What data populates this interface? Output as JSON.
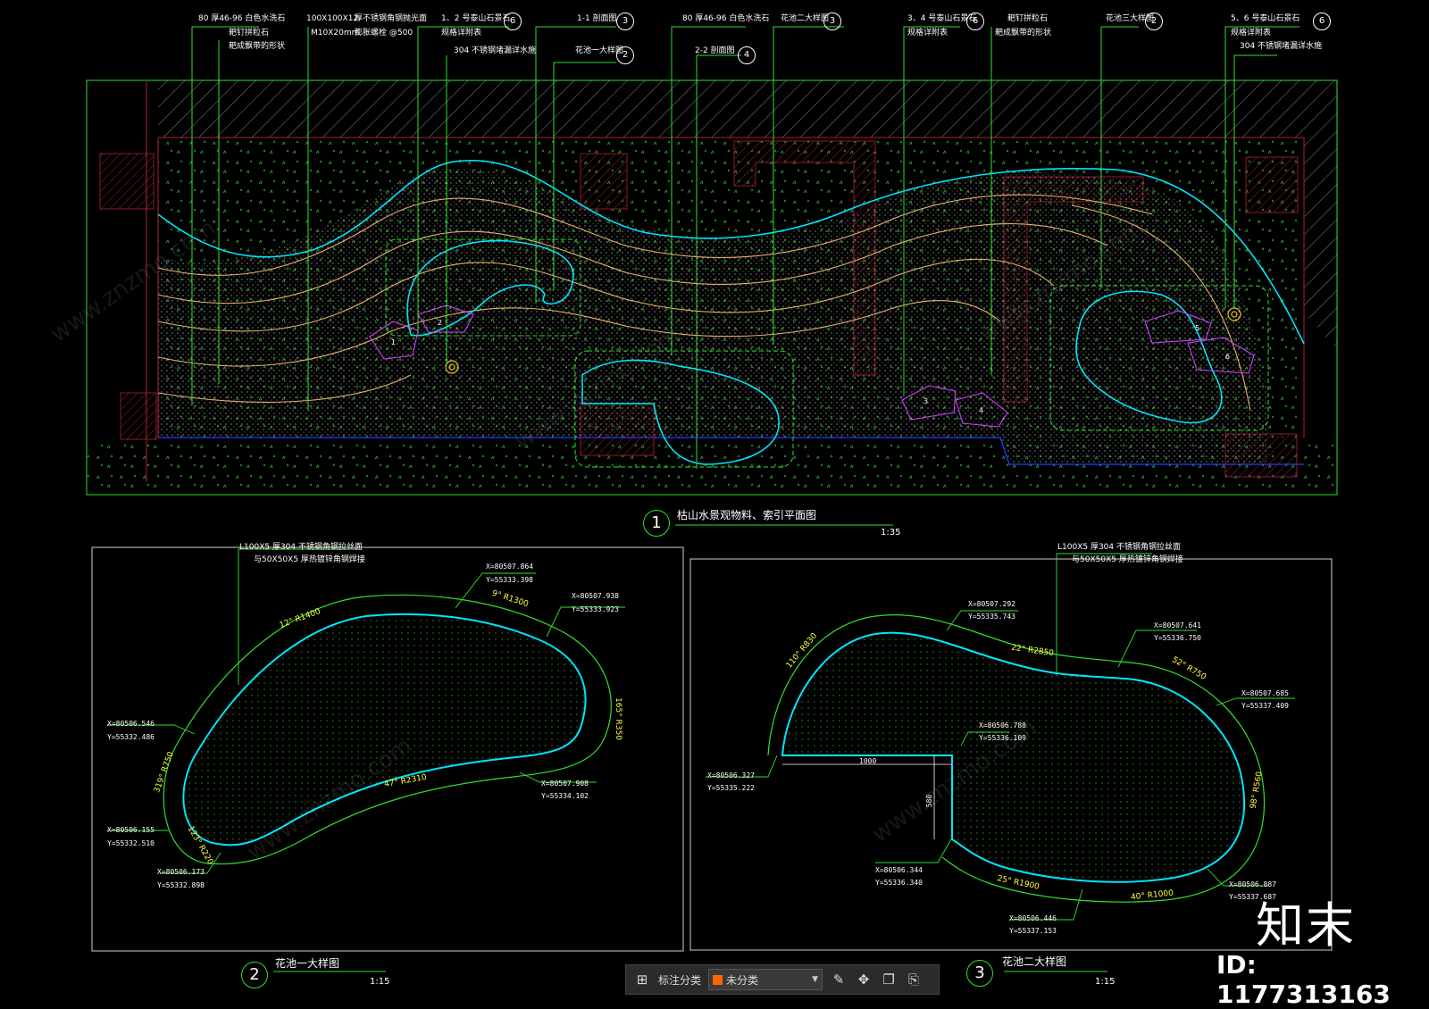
{
  "colors": {
    "bg": "#000000",
    "green": "#2ee02e",
    "cyan": "#00e5ff",
    "wall": "#8b1a2a",
    "tan": "#e8b070",
    "magenta": "#d040ff",
    "blue": "#2040ff",
    "white": "#ffffff",
    "yellow": "#ffff40"
  },
  "top_labels": {
    "l1a": "80 厚46-96 白色水洗石",
    "l1b": "耙钉拼粒石",
    "l1c": "耙成飘带的形状",
    "l2a": "100X100X12",
    "l2b": "M10X20mm",
    "l3a": "厚不锈钢角钢抛光面",
    "l3b": "膨胀螺栓 @500",
    "l4a": "1、2 号泰山石景石",
    "l4b": "规格详附表",
    "l5": "1-1 剖面图",
    "l6": "304 不锈钢堵漏详水施",
    "l7": "花池一大样图",
    "l8": "80 厚46-96 白色水洗石",
    "l9": "2-2 剖面图",
    "l10": "花池二大样图",
    "l11a": "3、4 号泰山石景石",
    "l11b": "规格详附表",
    "l12a": "耙钉拼粒石",
    "l12b": "耙成飘带的形状",
    "l13": "花池三大样图",
    "l14a": "5、6 号泰山石景石",
    "l14b": "规格详附表",
    "l15": "304 不锈钢堵漏详水施"
  },
  "tags": {
    "t1": "6",
    "t2": "3",
    "t3": "2",
    "t4": "4",
    "t5": "3",
    "t6": "6",
    "t7": "2",
    "t8": "6"
  },
  "stones": [
    "1",
    "2",
    "3",
    "4",
    "5",
    "6"
  ],
  "views": {
    "v1": {
      "num": "1",
      "title": "枯山水景观物料、索引平面图",
      "scale": "1:35"
    },
    "v2": {
      "num": "2",
      "title": "花池一大样图",
      "scale": "1:15"
    },
    "v3": {
      "num": "3",
      "title": "花池二大样图",
      "scale": "1:15"
    }
  },
  "detail1": {
    "note_a": "L100X5    厚304  不锈钢角钢拉丝面",
    "note_b": "与50X50X5    厚热镀锌角钢焊接",
    "arcs": {
      "a1": "12° R1400",
      "a2": "9° R1300",
      "a3": "165° R350",
      "a4": "47° R2310",
      "a5": "123° R220",
      "a6": "319° R750"
    },
    "coords": {
      "c1x": "X=80507.864",
      "c1y": "Y=55333.398",
      "c2x": "X=80507.938",
      "c2y": "Y=55333.923",
      "c3x": "X=80506.546",
      "c3y": "Y=55332.486",
      "c4x": "X=80507.908",
      "c4y": "Y=55334.102",
      "c5x": "X=80506.155",
      "c5y": "Y=55332.510",
      "c6x": "X=80506.173",
      "c6y": "Y=55332.898"
    }
  },
  "detail2": {
    "note_a": "L100X5    厚304  不锈钢角钢拉丝面",
    "note_b": "与50X50X5    厚热镀锌角钢焊接",
    "arcs": {
      "a1": "110° R830",
      "a2": "22° R2850",
      "a3": "52° R750",
      "a4": "98° R560",
      "a5": "40° R1000",
      "a6": "25° R1900"
    },
    "dims": {
      "d1": "1000",
      "d2": "580"
    },
    "coords": {
      "c1x": "X=80507.292",
      "c1y": "Y=55335.743",
      "c2x": "X=80507.641",
      "c2y": "Y=55336.750",
      "c3x": "X=80506.788",
      "c3y": "Y=55336.109",
      "c4x": "X=80507.685",
      "c4y": "Y=55337.409",
      "c5x": "X=80506.327",
      "c5y": "Y=55335.222",
      "c6x": "X=80506.344",
      "c6y": "Y=55336.340",
      "c7x": "X=80506.887",
      "c7y": "Y=55337.687",
      "c8x": "X=80506.446",
      "c8y": "Y=55337.153"
    }
  },
  "toolbar": {
    "label": "标注分类",
    "select_value": "未分类"
  },
  "watermark": {
    "logo": "知末",
    "id": "ID: 1177313163",
    "text": "www.znzmo.com"
  }
}
